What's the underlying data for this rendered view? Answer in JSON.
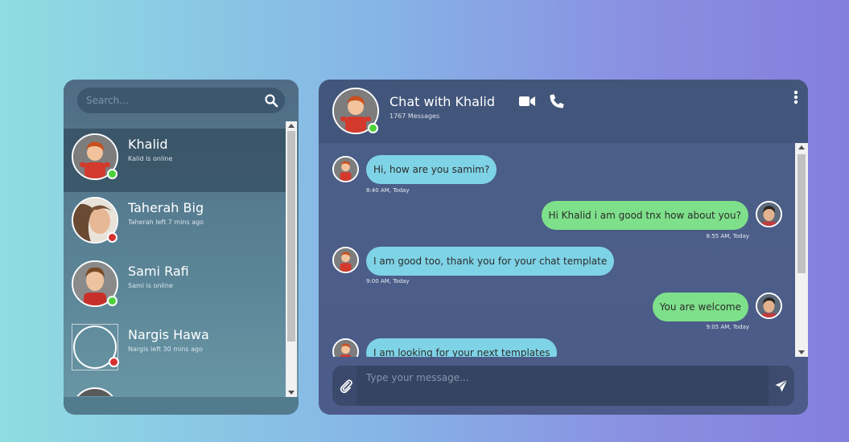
{
  "search": {
    "placeholder": "Search...",
    "icon": "search-icon"
  },
  "contacts": [
    {
      "name": "Khalid",
      "status_text": "Kalid is online",
      "presence": "online",
      "active": true
    },
    {
      "name": "Taherah Big",
      "status_text": "Taherah left 7 mins ago",
      "presence": "offline",
      "active": false
    },
    {
      "name": "Sami Rafi",
      "status_text": "Sami is online",
      "presence": "online",
      "active": false
    },
    {
      "name": "Nargis Hawa",
      "status_text": "Nargis left 30 mins ago",
      "presence": "offline",
      "active": false
    }
  ],
  "chat": {
    "title": "Chat with Khalid",
    "message_count": "1767 Messages",
    "icons": [
      "video-icon",
      "phone-icon",
      "menu-icon"
    ]
  },
  "messages": [
    {
      "direction": "in",
      "text": "Hi, how are you samim?",
      "time": "8:40 AM, Today"
    },
    {
      "direction": "out",
      "text": "Hi Khalid i am good tnx how about you?",
      "time": "8:55 AM, Today"
    },
    {
      "direction": "in",
      "text": "I am good too, thank you for your chat template",
      "time": "9:00 AM, Today"
    },
    {
      "direction": "out",
      "text": "You are welcome",
      "time": "9:05 AM, Today"
    },
    {
      "direction": "in",
      "text": "I am looking for your next templates",
      "time": ""
    }
  ],
  "composer": {
    "placeholder": "Type your message...",
    "attach_icon": "paperclip-icon",
    "send_icon": "send-icon"
  },
  "colors": {
    "online": "#4cd137",
    "offline": "#d63031",
    "incoming_bubble": "#7fd3e6",
    "outgoing_bubble": "#7ee08a"
  }
}
